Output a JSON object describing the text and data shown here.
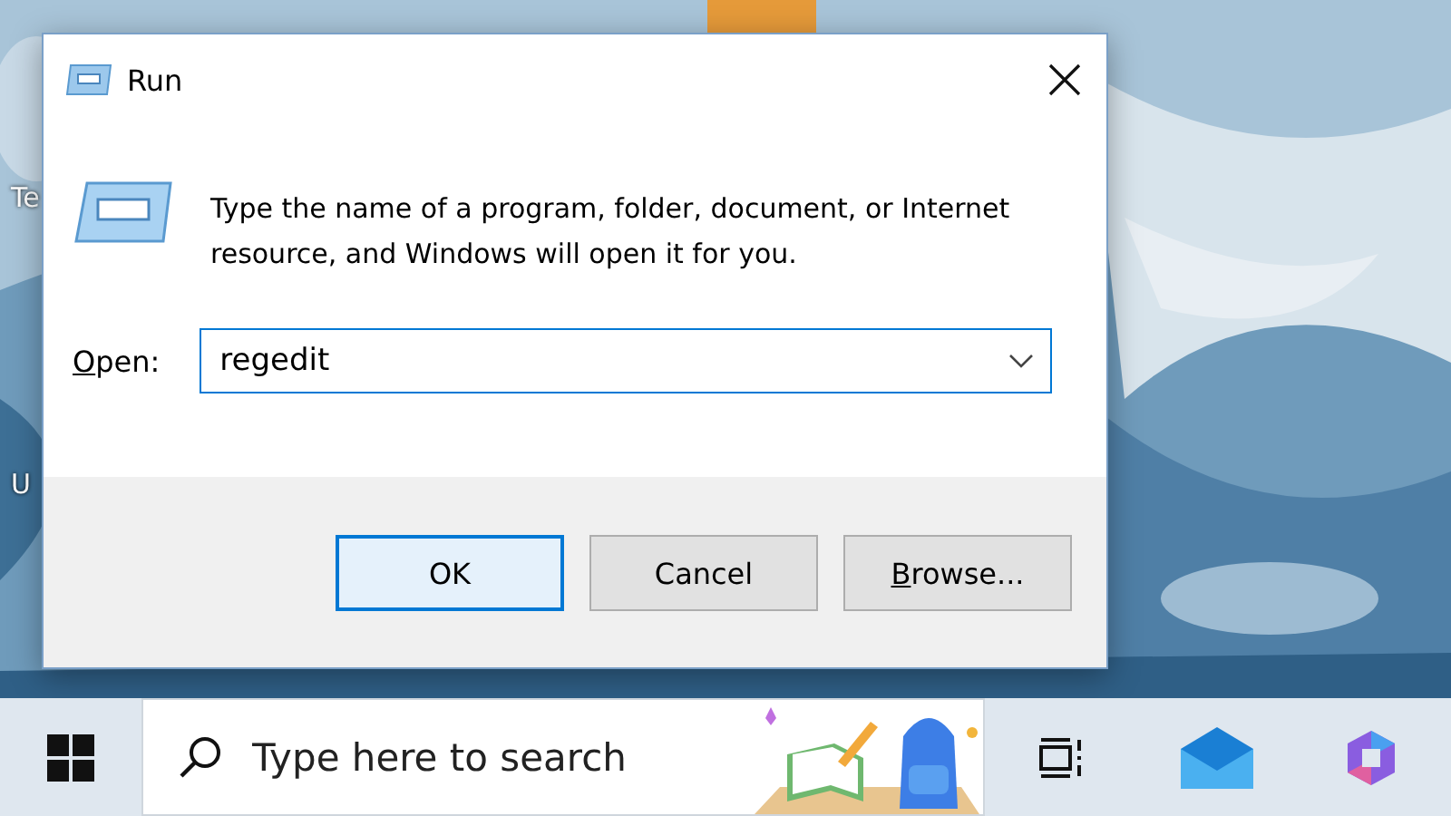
{
  "desktop": {
    "icon_labels": [
      "Te",
      "U"
    ]
  },
  "dialog": {
    "title": "Run",
    "message": "Type the name of a program, folder, document, or Internet resource, and Windows will open it for you.",
    "open_label": "Open:",
    "open_value": "regedit",
    "buttons": [
      {
        "label": "OK",
        "selected": true
      },
      {
        "label": "Cancel",
        "selected": false
      },
      {
        "label": "Browse...",
        "selected": false
      }
    ]
  },
  "taskbar": {
    "search": {
      "placeholder": "Type here to search"
    }
  }
}
